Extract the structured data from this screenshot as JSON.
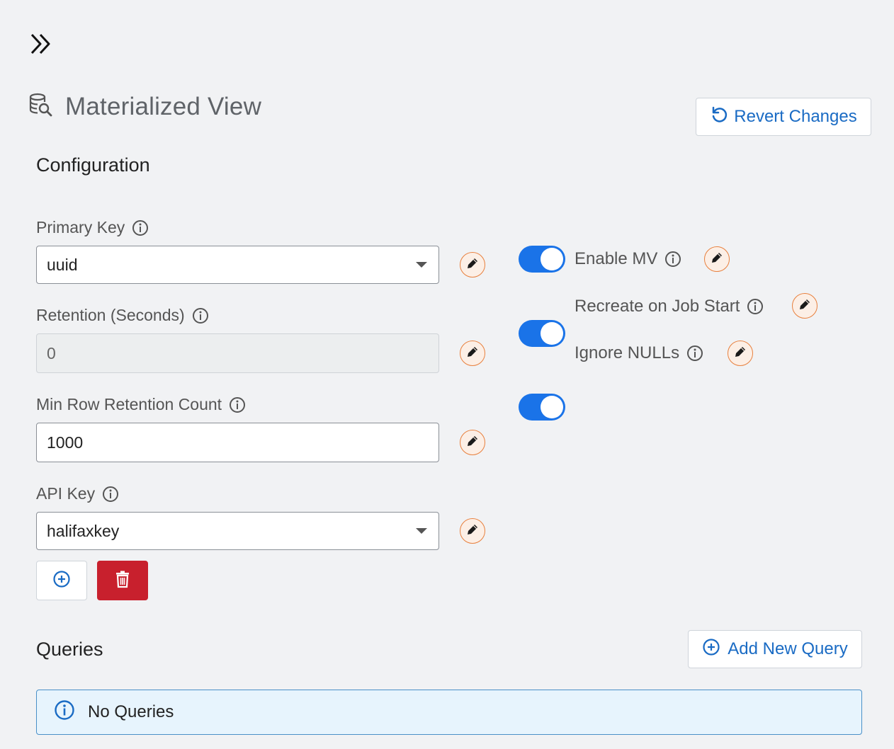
{
  "page": {
    "title": "Materialized View",
    "revert_label": "Revert Changes"
  },
  "configuration": {
    "title": "Configuration",
    "primary_key": {
      "label": "Primary Key",
      "value": "uuid"
    },
    "retention": {
      "label": "Retention (Seconds)",
      "value": "0"
    },
    "min_row": {
      "label": "Min Row Retention Count",
      "value": "1000"
    },
    "api_key": {
      "label": "API Key",
      "value": "halifaxkey"
    }
  },
  "toggles": [
    {
      "label": "Enable MV",
      "on": true
    },
    {
      "label": "Recreate on Job Start",
      "on": true
    },
    {
      "label": "Ignore NULLs",
      "on": true
    }
  ],
  "queries": {
    "title": "Queries",
    "add_label": "Add New Query",
    "empty_text": "No Queries"
  },
  "colors": {
    "accent": "#1a73e8",
    "link": "#1a6bc4",
    "danger": "#c8202d",
    "edit_border": "#e8803e",
    "alert_bg": "#e7f4fd"
  },
  "icons": {
    "expand": "double-chevron-right-icon",
    "title": "database-search-icon",
    "revert": "undo-icon",
    "edit": "pencil-icon",
    "info": "info-icon",
    "add": "plus-circle-icon",
    "delete": "trash-icon"
  }
}
